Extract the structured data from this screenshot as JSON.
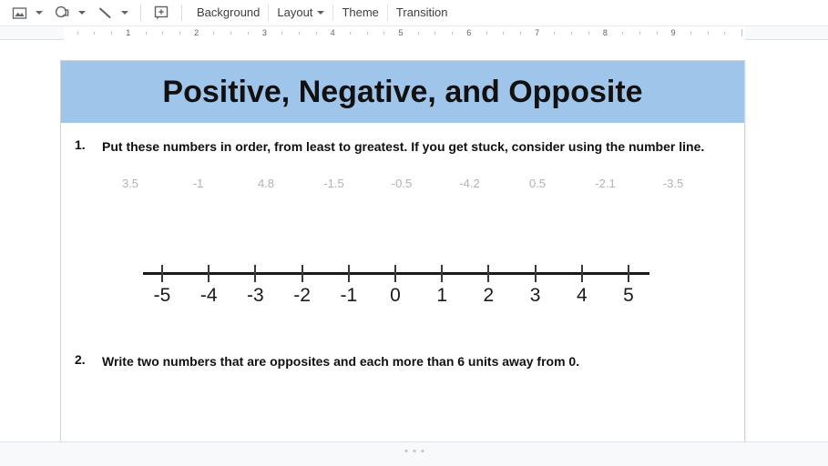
{
  "toolbar": {
    "items": [
      {
        "name": "insert-image-button",
        "icon": "image-icon",
        "caret": true
      },
      {
        "name": "insert-shape-button",
        "icon": "shape-icon",
        "caret": true
      },
      {
        "name": "insert-line-button",
        "icon": "line-icon",
        "caret": true
      },
      {
        "name": "insert-textbox-button",
        "icon": "textbox-icon",
        "caret": false
      }
    ],
    "background_label": "Background",
    "layout_label": "Layout",
    "theme_label": "Theme",
    "transition_label": "Transition"
  },
  "ruler": {
    "numbers": [
      "1",
      "2",
      "3",
      "4",
      "5",
      "6",
      "7",
      "8",
      "9"
    ]
  },
  "slide": {
    "title": "Positive, Negative, and Opposite",
    "banner_color": "#9fc5ea",
    "questions": [
      {
        "number": "1.",
        "text": "Put these numbers in order, from least to greatest. If you get stuck, consider using the number line."
      },
      {
        "number": "2.",
        "text": "Write two numbers that are opposites and each more than 6 units away from 0."
      }
    ],
    "number_list": [
      "3.5",
      "-1",
      "4.8",
      "-1.5",
      "-0.5",
      "-4.2",
      "0.5",
      "-2.1",
      "-3.5"
    ],
    "number_line": {
      "labels": [
        "-5",
        "-4",
        "-3",
        "-2",
        "-1",
        "0",
        "1",
        "2",
        "3",
        "4",
        "5"
      ],
      "min": -5,
      "max": 5
    }
  }
}
